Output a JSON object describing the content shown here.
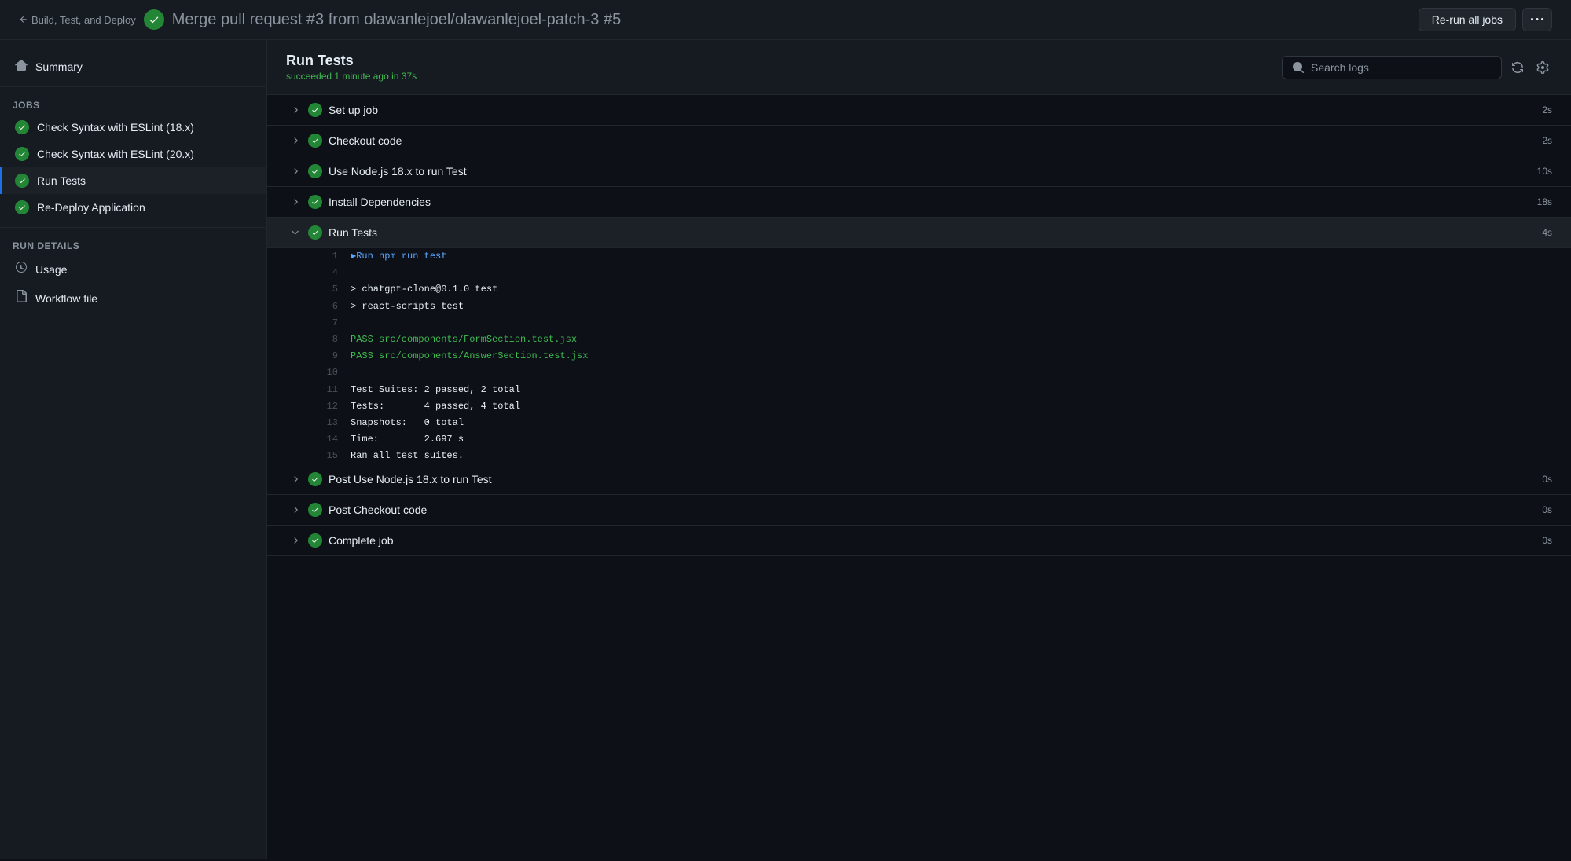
{
  "topbar": {
    "back_label": "Build, Test, and Deploy",
    "title": "Merge pull request #3 from olawanlejoel/olawanlejoel-patch-3",
    "run_number": "#5",
    "rerun_label": "Re-run all jobs"
  },
  "sidebar": {
    "summary_label": "Summary",
    "jobs_section": "Jobs",
    "jobs": [
      {
        "id": "job-eslint-18",
        "label": "Check Syntax with ESLint (18.x)",
        "status": "success"
      },
      {
        "id": "job-eslint-20",
        "label": "Check Syntax with ESLint (20.x)",
        "status": "success"
      },
      {
        "id": "job-run-tests",
        "label": "Run Tests",
        "status": "success",
        "active": true
      },
      {
        "id": "job-redeploy",
        "label": "Re-Deploy Application",
        "status": "success"
      }
    ],
    "run_details_section": "Run details",
    "run_details": [
      {
        "id": "usage",
        "label": "Usage",
        "icon": "clock"
      },
      {
        "id": "workflow-file",
        "label": "Workflow file",
        "icon": "file"
      }
    ]
  },
  "job": {
    "title": "Run Tests",
    "subtitle": "succeeded",
    "time": "1 minute ago in 37s",
    "search_placeholder": "Search logs"
  },
  "steps": [
    {
      "id": "set-up-job",
      "name": "Set up job",
      "duration": "2s",
      "expanded": false
    },
    {
      "id": "checkout-code",
      "name": "Checkout code",
      "duration": "2s",
      "expanded": false
    },
    {
      "id": "use-nodejs",
      "name": "Use Node.js 18.x to run Test",
      "duration": "10s",
      "expanded": false
    },
    {
      "id": "install-deps",
      "name": "Install Dependencies",
      "duration": "18s",
      "expanded": false
    },
    {
      "id": "run-tests",
      "name": "Run Tests",
      "duration": "4s",
      "expanded": true
    },
    {
      "id": "post-use-nodejs",
      "name": "Post Use Node.js 18.x to run Test",
      "duration": "0s",
      "expanded": false
    },
    {
      "id": "post-checkout",
      "name": "Post Checkout code",
      "duration": "0s",
      "expanded": false
    },
    {
      "id": "complete-job",
      "name": "Complete job",
      "duration": "0s",
      "expanded": false
    }
  ],
  "log_lines": [
    {
      "num": "1",
      "text": "▶Run npm run test",
      "style": "cmd"
    },
    {
      "num": "4",
      "text": "",
      "style": "normal"
    },
    {
      "num": "5",
      "text": "> chatgpt-clone@0.1.0 test",
      "style": "normal"
    },
    {
      "num": "6",
      "text": "> react-scripts test",
      "style": "normal"
    },
    {
      "num": "7",
      "text": "",
      "style": "normal"
    },
    {
      "num": "8",
      "text": "PASS src/components/FormSection.test.jsx",
      "style": "pass"
    },
    {
      "num": "9",
      "text": "PASS src/components/AnswerSection.test.jsx",
      "style": "pass"
    },
    {
      "num": "10",
      "text": "",
      "style": "normal"
    },
    {
      "num": "11",
      "text": "Test Suites: 2 passed, 2 total",
      "style": "normal"
    },
    {
      "num": "12",
      "text": "Tests:       4 passed, 4 total",
      "style": "normal"
    },
    {
      "num": "13",
      "text": "Snapshots:   0 total",
      "style": "normal"
    },
    {
      "num": "14",
      "text": "Time:        2.697 s",
      "style": "normal"
    },
    {
      "num": "15",
      "text": "Ran all test suites.",
      "style": "normal"
    }
  ]
}
